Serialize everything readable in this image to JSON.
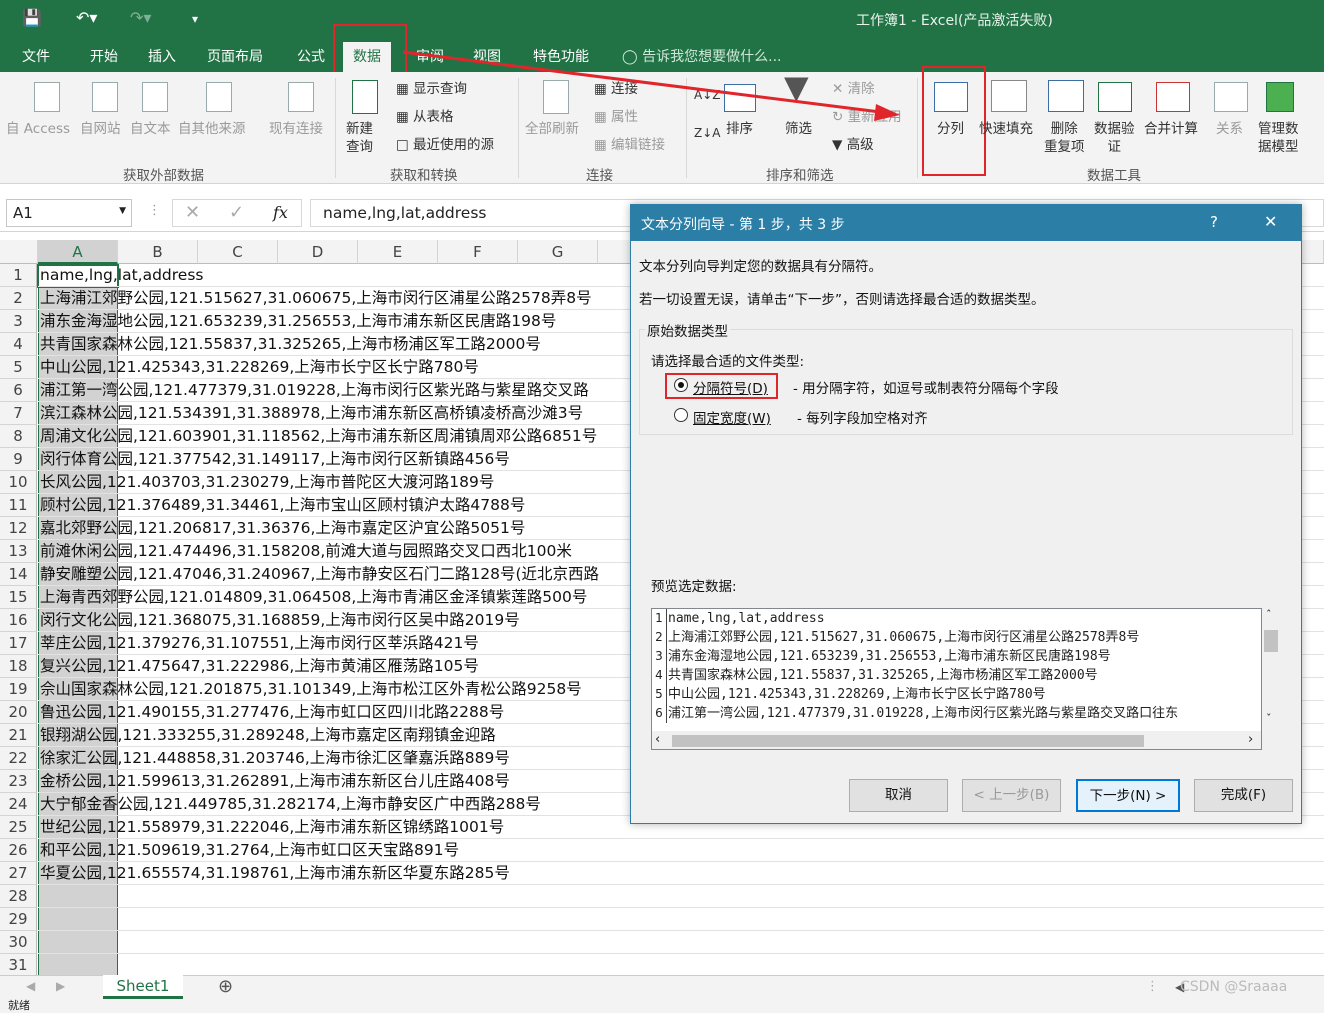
{
  "window": {
    "title": "工作簿1 - Excel(产品激活失败)"
  },
  "tabs": [
    "文件",
    "开始",
    "插入",
    "页面布局",
    "公式",
    "数据",
    "审阅",
    "视图",
    "特色功能"
  ],
  "tell_me": "告诉我您想要做什么...",
  "ribbon": {
    "external": [
      "自 Access",
      "自网站",
      "自文本",
      "自其他来源",
      "现有连接"
    ],
    "external_group": "获取外部数据",
    "transform": {
      "new_query": "新建\n查询",
      "show_query": "显示查询",
      "from_table": "从表格",
      "recent": "最近使用的源"
    },
    "transform_group": "获取和转换",
    "connections": {
      "refresh": "全部刷新",
      "connect": "连接",
      "props": "属性",
      "edit_links": "编辑链接"
    },
    "connections_group": "连接",
    "sort": {
      "sort": "排序",
      "filter": "筛选",
      "clear": "清除",
      "reapply": "重新应用",
      "advanced": "高级"
    },
    "sort_group": "排序和筛选",
    "tools": {
      "split": "分列",
      "flash": "快速填充",
      "remove_dup": "删除\n重复项",
      "validate": "数据验\n证",
      "consolidate": "合并计算",
      "relations": "关系",
      "model": "管理数\n据模型"
    },
    "tools_group": "数据工具"
  },
  "formula_bar": {
    "name_box": "A1",
    "fx": "fx",
    "content": "name,lng,lat,address"
  },
  "columns": [
    "A",
    "B",
    "C",
    "D",
    "E",
    "F",
    "G"
  ],
  "rows": [
    "name,lng,lat,address",
    "上海浦江郊野公园,121.515627,31.060675,上海市闵行区浦星公路2578弄8号",
    "浦东金海湿地公园,121.653239,31.256553,上海市浦东新区民唐路198号",
    "共青国家森林公园,121.55837,31.325265,上海市杨浦区军工路2000号",
    "中山公园,121.425343,31.228269,上海市长宁区长宁路780号",
    "浦江第一湾公园,121.477379,31.019228,上海市闵行区紫光路与紫星路交叉路",
    "滨江森林公园,121.534391,31.388978,上海市浦东新区高桥镇凌桥高沙滩3号",
    "周浦文化公园,121.603901,31.118562,上海市浦东新区周浦镇周邓公路6851号",
    "闵行体育公园,121.377542,31.149117,上海市闵行区新镇路456号",
    "长风公园,121.403703,31.230279,上海市普陀区大渡河路189号",
    "顾村公园,121.376489,31.34461,上海市宝山区顾村镇沪太路4788号",
    "嘉北郊野公园,121.206817,31.36376,上海市嘉定区沪宜公路5051号",
    "前滩休闲公园,121.474496,31.158208,前滩大道与园照路交叉口西北100米",
    "静安雕塑公园,121.47046,31.240967,上海市静安区石门二路128号(近北京西路",
    "上海青西郊野公园,121.014809,31.064508,上海市青浦区金泽镇紫莲路500号",
    "闵行文化公园,121.368075,31.168859,上海市闵行区吴中路2019号",
    "莘庄公园,121.379276,31.107551,上海市闵行区莘浜路421号",
    "复兴公园,121.475647,31.222986,上海市黄浦区雁荡路105号",
    "佘山国家森林公园,121.201875,31.101349,上海市松江区外青松公路9258号",
    "鲁迅公园,121.490155,31.277476,上海市虹口区四川北路2288号",
    "银翔湖公园,121.333255,31.289248,上海市嘉定区南翔镇金迎路",
    "徐家汇公园,121.448858,31.203746,上海市徐汇区肇嘉浜路889号",
    "金桥公园,121.599613,31.262891,上海市浦东新区台儿庄路408号",
    "大宁郁金香公园,121.449785,31.282174,上海市静安区广中西路288号",
    "世纪公园,121.558979,31.222046,上海市浦东新区锦绣路1001号",
    "和平公园,121.509619,31.2764,上海市虹口区天宝路891号",
    "华夏公园,121.655574,31.198761,上海市浦东新区华夏东路285号",
    "",
    "",
    "",
    ""
  ],
  "sheet_tab": "Sheet1",
  "watermark": "CSDN @Sraaaa",
  "status": "就绪",
  "dialog": {
    "title": "文本分列向导 - 第 1 步，共 3 步",
    "help": "?",
    "close": "✕",
    "line1": "文本分列向导判定您的数据具有分隔符。",
    "line2": "若一切设置无误，请单击“下一步”，否则请选择最合适的数据类型。",
    "group": "原始数据类型",
    "prompt": "请选择最合适的文件类型:",
    "opt1": "分隔符号(D)",
    "opt1_desc": "- 用分隔字符，如逗号或制表符分隔每个字段",
    "opt2": "固定宽度(W)",
    "opt2_desc": "- 每列字段加空格对齐",
    "preview_label": "预览选定数据:",
    "preview": [
      "name,lng,lat,address",
      "上海浦江郊野公园,121.515627,31.060675,上海市闵行区浦星公路2578弄8号",
      "浦东金海湿地公园,121.653239,31.256553,上海市浦东新区民唐路198号",
      "共青国家森林公园,121.55837,31.325265,上海市杨浦区军工路2000号",
      "中山公园,121.425343,31.228269,上海市长宁区长宁路780号",
      "浦江第一湾公园,121.477379,31.019228,上海市闵行区紫光路与紫星路交叉路口往东"
    ],
    "buttons": {
      "cancel": "取消",
      "back": "< 上一步(B)",
      "next": "下一步(N) >",
      "finish": "完成(F)"
    }
  }
}
